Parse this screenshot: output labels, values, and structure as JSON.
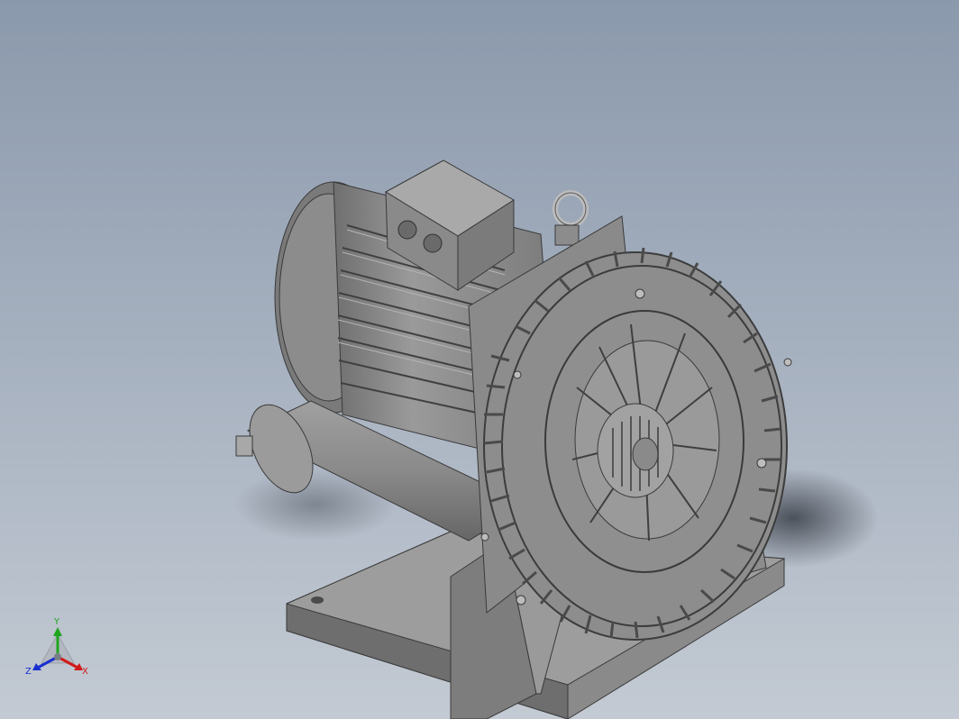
{
  "viewport": {
    "background_top": "#8b99ac",
    "background_bottom": "#c3cad3"
  },
  "model": {
    "icon": "regenerative-blower-3d-model",
    "body_color": "#8f8f8f"
  },
  "triad": {
    "x_label": "X",
    "y_label": "Y",
    "z_label": "Z",
    "x_color": "#d11a1a",
    "y_color": "#1fa61f",
    "z_color": "#1a2fcf"
  }
}
